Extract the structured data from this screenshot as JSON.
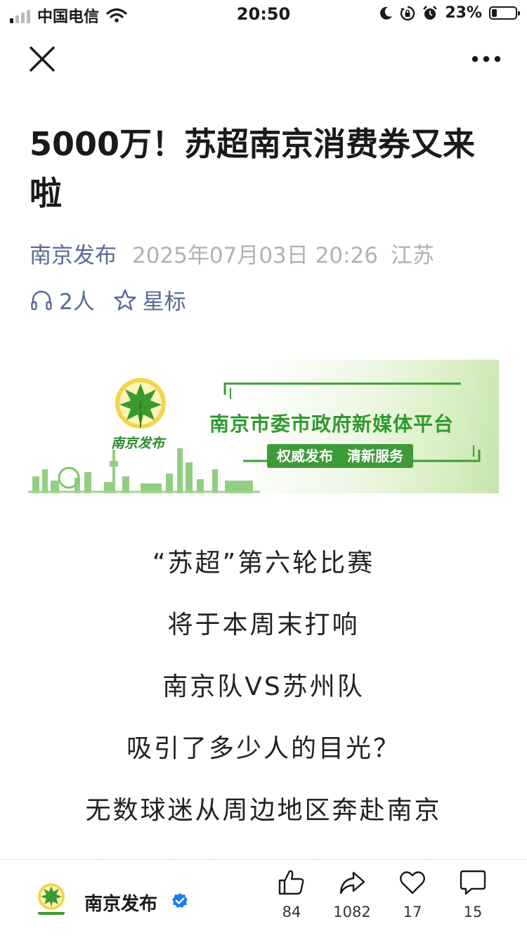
{
  "status_bar": {
    "carrier": "中国电信",
    "time": "20:50",
    "battery_percent": "23%",
    "battery_level": 0.23,
    "signal_icon": "signal-bars-icon",
    "wifi_icon": "wifi-icon",
    "moon_icon": "do-not-disturb-moon-icon",
    "lock_icon": "rotation-lock-icon",
    "alarm_icon": "alarm-clock-icon"
  },
  "nav": {
    "close_icon": "close-icon",
    "more_icon": "more-dots-icon"
  },
  "article": {
    "title": "5000万！苏超南京消费券又来啦",
    "account": "南京发布",
    "datetime": "2025年07月03日 20:26",
    "location": "江苏",
    "listeners": "2人",
    "star_label": "星标"
  },
  "banner": {
    "headline": "南京市委市政府新媒体平台",
    "tagline": "权威发布　清新服务",
    "logo_text": "南京发布",
    "accent_color": "#2f9a2f"
  },
  "body_lines": [
    "“苏超”第六轮比赛",
    "将于本周末打响",
    "南京队VS苏州队",
    "吸引了多少人的目光？",
    "无数球迷从周边地区奔赴南京",
    "也有无数球迷早早守候了门外"
  ],
  "bottom_bar": {
    "account_name": "南京发布",
    "verified_icon": "verified-badge-icon",
    "like_count": "84",
    "share_count": "1082",
    "recommend_count": "17",
    "comment_count": "15"
  },
  "colors": {
    "link_blue": "#576b95",
    "meta_gray": "#b2b2b2",
    "brand_green": "#3e9b3a",
    "verified_blue": "#1e7bf0"
  }
}
